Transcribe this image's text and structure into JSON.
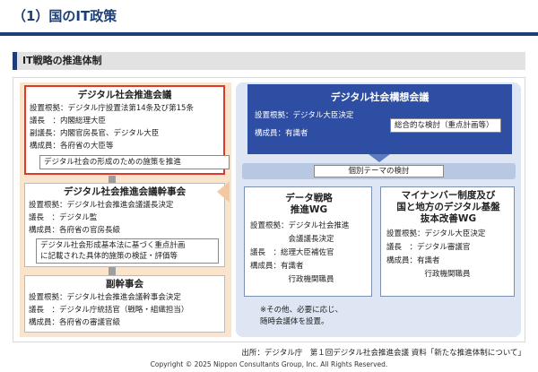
{
  "header": {
    "title": "（1）国のIT政策"
  },
  "section": {
    "title": "IT戦略の推進体制"
  },
  "council": {
    "title": "デジタル社会推進会議",
    "lines": [
      "設置根拠：デジタル庁設置法第14条及び第15条",
      "議長　：内閣総理大臣",
      "副議長：内閣官房長官、デジタル大臣",
      "構成員：各府省の大臣等"
    ],
    "highlight": "デジタル社会の形成のための施策を推進"
  },
  "secretariat": {
    "title": "デジタル社会推進会議幹事会",
    "lines": [
      "設置根拠：デジタル社会推進会議議長決定",
      "議長　：デジタル監",
      "構成員：各府省の官房長級"
    ],
    "highlight_lines": [
      "デジタル社会形成基本法に基づく重点計画",
      "に記載された具体的施策の検証・評価等"
    ]
  },
  "vice_secretariat": {
    "title": "副幹事会",
    "lines": [
      "設置根拠：デジタル社会推進会議幹事会決定",
      "議長　：デジタル庁統括官（戦略・組織担当）",
      "構成員：各府省の審議官級"
    ]
  },
  "concept_council": {
    "title": "デジタル社会構想会議",
    "lines": [
      "設置根拠：デジタル大臣決定",
      "構成員：有識者"
    ],
    "highlight": "総合的な検討（重点計画等）"
  },
  "theme_label": "個別テーマの検討",
  "wg_data": {
    "title_lines": [
      "データ戦略",
      "推進WG"
    ],
    "lines": [
      "設置根拠：デジタル社会推進",
      "　　　　　会議議長決定",
      "議長　：総理大臣補佐官",
      "構成員：有識者",
      "　　　　　行政機関職員"
    ]
  },
  "wg_mynumber": {
    "title_lines": [
      "マイナンバー制度及び",
      "国と地方のデジタル基盤",
      "抜本改善WG"
    ],
    "lines": [
      "設置根拠：デジタル大臣決定",
      "議長　：デジタル審議官",
      "構成員：有識者",
      "　　　　　行政機関職員"
    ]
  },
  "note_lines": [
    "※その他、必要に応じ、",
    "随時会議体を設置。"
  ],
  "source": "出所：デジタル庁　第１回デジタル社会推進会議 資料「新たな推進体制について」",
  "copyright": "Copyright © 2025 Nippon Consultants Group, Inc. All Rights Reserved.",
  "colors": {
    "navy": "#1c3f7a",
    "council_border": "#e0392b",
    "concept_blue": "#2e4ea3",
    "left_bg": "#fbe4cc",
    "right_bg": "#dde6f2"
  }
}
